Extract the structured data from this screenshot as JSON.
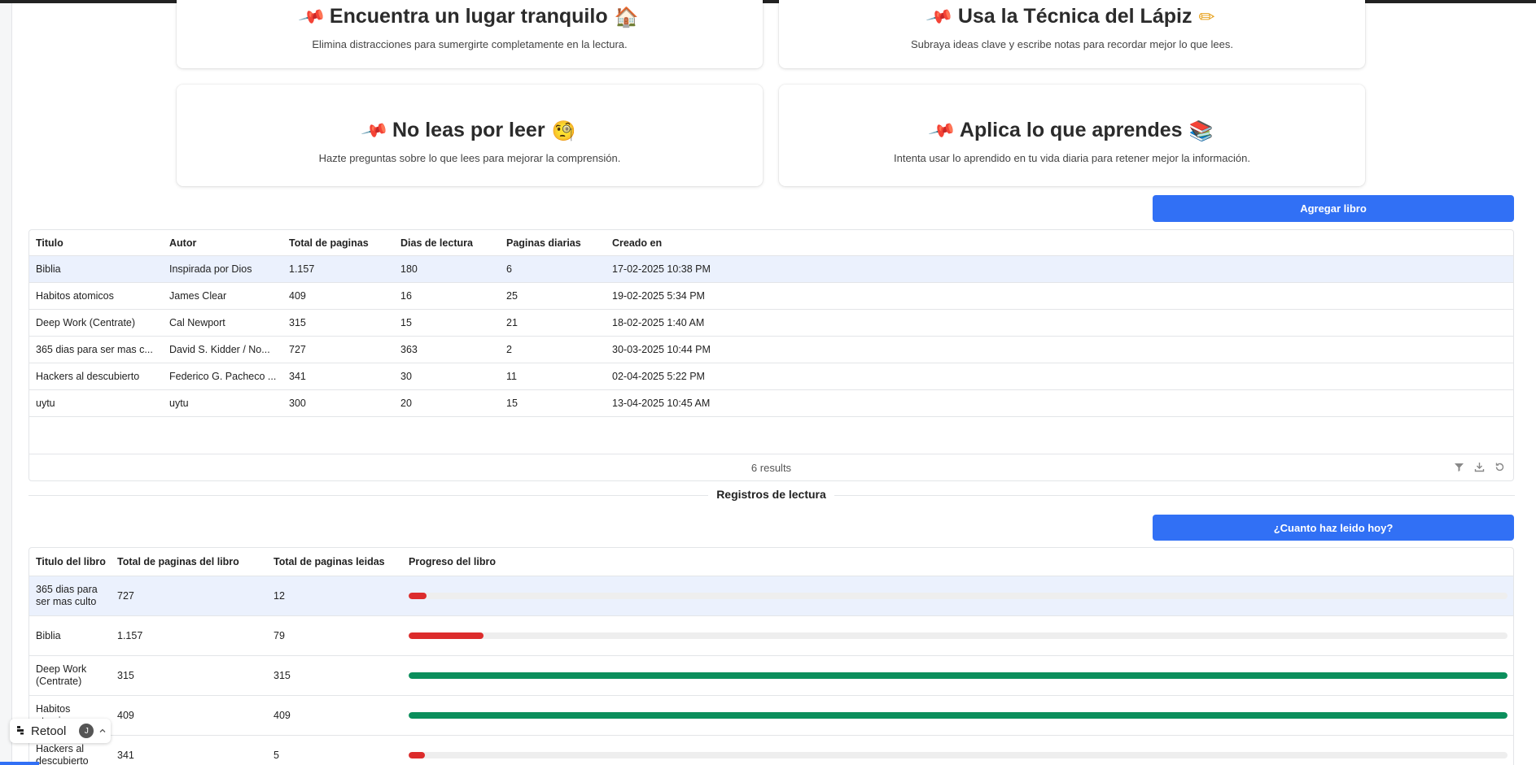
{
  "tips": [
    {
      "title": "Encuentra un lugar tranquilo",
      "emoji": "🏠",
      "desc": "Elimina distracciones para sumergirte completamente en la lectura."
    },
    {
      "title": "Usa la Técnica del Lápiz",
      "emoji": "✏",
      "desc": "Subraya ideas clave y escribe notas para recordar mejor lo que lees."
    },
    {
      "title": "No leas por leer",
      "emoji": "🧐",
      "desc": "Hazte preguntas sobre lo que lees para mejorar la comprensión."
    },
    {
      "title": "Aplica lo que aprendes",
      "emoji": "📚",
      "desc": "Intenta usar lo aprendido en tu vida diaria para retener mejor la información."
    }
  ],
  "books": {
    "add_button": "Agregar libro",
    "headers": [
      "Titulo",
      "Autor",
      "Total de paginas",
      "Dias de lectura",
      "Paginas diarias",
      "Creado en"
    ],
    "rows": [
      [
        "Biblia",
        "Inspirada por Dios",
        "1.157",
        "180",
        "6",
        "17-02-2025 10:38 PM"
      ],
      [
        "Habitos atomicos",
        "James Clear",
        "409",
        "16",
        "25",
        "19-02-2025 5:34 PM"
      ],
      [
        "Deep Work (Centrate)",
        "Cal Newport",
        "315",
        "15",
        "21",
        "18-02-2025 1:40 AM"
      ],
      [
        "365 dias para ser mas c...",
        "David S. Kidder / No...",
        "727",
        "363",
        "2",
        "30-03-2025 10:44 PM"
      ],
      [
        "Hackers al descubierto",
        "Federico G. Pacheco ...",
        "341",
        "30",
        "11",
        "02-04-2025 5:22 PM"
      ],
      [
        "uytu",
        "uytu",
        "300",
        "20",
        "15",
        "13-04-2025 10:45 AM"
      ]
    ],
    "results": "6 results"
  },
  "section_title": "Registros de lectura",
  "logs": {
    "log_button": "¿Cuanto haz leido hoy?",
    "headers": [
      "Titulo del libro",
      "Total de paginas del libro",
      "Total de paginas leidas",
      "Progreso del libro"
    ],
    "rows": [
      {
        "title": "365 dias para ser mas culto",
        "total": "727",
        "read": "12",
        "progress": 0.0165,
        "color": "#dc2c2c"
      },
      {
        "title": "Biblia",
        "total": "1.157",
        "read": "79",
        "progress": 0.068,
        "color": "#dc2c2c"
      },
      {
        "title": "Deep Work (Centrate)",
        "total": "315",
        "read": "315",
        "progress": 1.0,
        "color": "#0b8f5c"
      },
      {
        "title": "Habitos atomicos",
        "total": "409",
        "read": "409",
        "progress": 1.0,
        "color": "#0b8f5c"
      },
      {
        "title": "Hackers al descubierto",
        "total": "341",
        "read": "5",
        "progress": 0.0147,
        "color": "#dc2c2c"
      }
    ]
  },
  "retool": {
    "brand": "Retool",
    "avatar": "J"
  }
}
